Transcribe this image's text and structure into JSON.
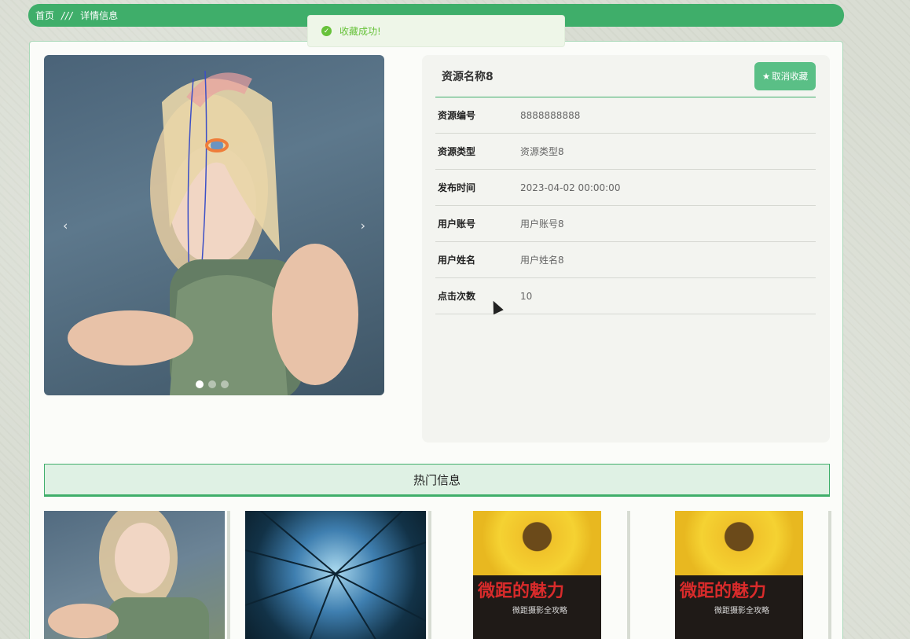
{
  "breadcrumb": {
    "home": "首页",
    "separator": "///",
    "current": "详情信息"
  },
  "toast": {
    "message": "收藏成功!",
    "icon": "check-circle-icon"
  },
  "carousel": {
    "prev": "‹",
    "next": "›",
    "slide_count": 3,
    "active_index": 0
  },
  "detail": {
    "title": "资源名称8",
    "fav_button": "取消收藏",
    "fav_icon": "star-icon",
    "rows": [
      {
        "label": "资源编号",
        "value": "8888888888"
      },
      {
        "label": "资源类型",
        "value": "资源类型8"
      },
      {
        "label": "发布时间",
        "value": "2023-04-02 00:00:00"
      },
      {
        "label": "用户账号",
        "value": "用户账号8"
      },
      {
        "label": "用户姓名",
        "value": "用户姓名8"
      },
      {
        "label": "点击次数",
        "value": "10"
      }
    ]
  },
  "hot": {
    "title": "热门信息",
    "book_title": "微距的魅力",
    "book_subtitle": "微距摄影全攻略"
  },
  "colors": {
    "accent": "#3fae6a",
    "button": "#5abf86",
    "toast": "#67c23a"
  }
}
